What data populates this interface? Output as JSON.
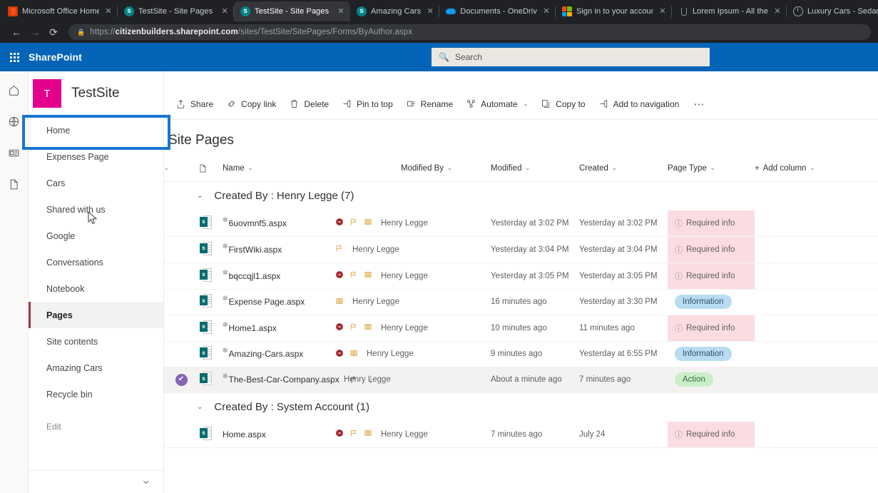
{
  "browser": {
    "tabs": [
      {
        "title": "Microsoft Office Home",
        "favicon": "office-icon",
        "active": false
      },
      {
        "title": "TestSite - Site Pages -",
        "favicon": "sharepoint-icon",
        "active": false
      },
      {
        "title": "TestSite - Site Pages -",
        "favicon": "sharepoint-icon",
        "active": true
      },
      {
        "title": "Amazing Cars",
        "favicon": "sharepoint-icon",
        "active": false
      },
      {
        "title": "Documents - OneDriv",
        "favicon": "onedrive-icon",
        "active": false
      },
      {
        "title": "Sign in to your accoun",
        "favicon": "microsoft-icon",
        "active": false
      },
      {
        "title": "Lorem Ipsum - All the",
        "favicon": "generic-icon",
        "active": false
      },
      {
        "title": "Luxury Cars - Sedans,",
        "favicon": "mercedes-icon",
        "active": false
      }
    ],
    "close_label": "✕",
    "back_icon": "←",
    "forward_icon": "→",
    "reload_icon": "⟳",
    "lock_icon": "🔒",
    "url_scheme": "https://",
    "url_domain": "citizenbuilders.sharepoint.com",
    "url_path": "/sites/TestSite/SitePages/Forms/ByAuthor.aspx"
  },
  "suite": {
    "waffle": "app-launcher-icon",
    "brand": "SharePoint",
    "search_icon": "search-icon",
    "search_placeholder": "Search"
  },
  "rail": {
    "items": [
      {
        "name": "home-icon"
      },
      {
        "name": "globe-icon"
      },
      {
        "name": "news-icon"
      },
      {
        "name": "document-icon"
      }
    ]
  },
  "site": {
    "logo_letter": "T",
    "logo_color": "#e3008c",
    "title": "TestSite",
    "nav": [
      {
        "label": "Home",
        "selected": false,
        "highlighted": true
      },
      {
        "label": "Expenses Page",
        "selected": false
      },
      {
        "label": "Cars",
        "selected": false
      },
      {
        "label": "Shared with us",
        "selected": false
      },
      {
        "label": "Google",
        "selected": false
      },
      {
        "label": "Conversations",
        "selected": false
      },
      {
        "label": "Notebook",
        "selected": false
      },
      {
        "label": "Pages",
        "selected": true
      },
      {
        "label": "Site contents",
        "selected": false
      },
      {
        "label": "Amazing Cars",
        "selected": false
      },
      {
        "label": "Recycle bin",
        "selected": false
      },
      {
        "label": "Edit",
        "selected": false,
        "muted": true
      }
    ],
    "collapse_icon": "chevron-down-icon"
  },
  "command_bar": [
    {
      "label": "Share",
      "icon": "share-icon",
      "chevron": false
    },
    {
      "label": "Copy link",
      "icon": "link-icon",
      "chevron": false
    },
    {
      "label": "Delete",
      "icon": "trash-icon",
      "chevron": false
    },
    {
      "label": "Pin to top",
      "icon": "pin-icon",
      "chevron": false
    },
    {
      "label": "Rename",
      "icon": "rename-icon",
      "chevron": false
    },
    {
      "label": "Automate",
      "icon": "automate-icon",
      "chevron": true
    },
    {
      "label": "Copy to",
      "icon": "copy-icon",
      "chevron": false
    },
    {
      "label": "Add to navigation",
      "icon": "add-nav-icon",
      "chevron": false
    }
  ],
  "command_more": "⋯",
  "list": {
    "title": "Site Pages",
    "columns": [
      {
        "key": "select",
        "label": "",
        "chevron": true
      },
      {
        "key": "icon",
        "label": "",
        "chevron": false
      },
      {
        "key": "name",
        "label": "Name",
        "chevron": true
      },
      {
        "key": "modified_by",
        "label": "Modified By",
        "chevron": true
      },
      {
        "key": "modified",
        "label": "Modified",
        "chevron": true
      },
      {
        "key": "created",
        "label": "Created",
        "chevron": true
      },
      {
        "key": "page_type",
        "label": "Page Type",
        "chevron": true
      }
    ],
    "add_column_label": "Add column",
    "groups": [
      {
        "title": "Created By : Henry Legge (7)",
        "rows": [
          {
            "name": "6uovmnf5.aspx",
            "new": true,
            "icons": [
              "error-icon",
              "flag-icon",
              "book-icon"
            ],
            "modified_by": "Henry Legge",
            "modified": "Yesterday at 3:02 PM",
            "created": "Yesterday at 3:02 PM",
            "page_type": "Required info",
            "page_type_style": "required",
            "selected": false
          },
          {
            "name": "FirstWiki.aspx",
            "new": true,
            "icons": [
              "flag-icon"
            ],
            "modified_by": "Henry Legge",
            "modified": "Yesterday at 3:04 PM",
            "created": "Yesterday at 3:04 PM",
            "page_type": "Required info",
            "page_type_style": "required",
            "selected": false
          },
          {
            "name": "bqccqjl1.aspx",
            "new": true,
            "icons": [
              "error-icon",
              "flag-icon",
              "book-icon"
            ],
            "modified_by": "Henry Legge",
            "modified": "Yesterday at 3:05 PM",
            "created": "Yesterday at 3:05 PM",
            "page_type": "Required info",
            "page_type_style": "required",
            "selected": false
          },
          {
            "name": "Expense Page.aspx",
            "new": true,
            "icons": [
              "book-icon"
            ],
            "modified_by": "Henry Legge",
            "modified": "16 minutes ago",
            "created": "Yesterday at 3:30 PM",
            "page_type": "Information",
            "page_type_style": "info",
            "selected": false
          },
          {
            "name": "Home1.aspx",
            "new": true,
            "icons": [
              "error-icon",
              "flag-icon",
              "book-icon"
            ],
            "modified_by": "Henry Legge",
            "modified": "10 minutes ago",
            "created": "11 minutes ago",
            "page_type": "Required info",
            "page_type_style": "required",
            "selected": false
          },
          {
            "name": "Amazing-Cars.aspx",
            "new": true,
            "icons": [
              "error-icon",
              "book-icon"
            ],
            "modified_by": "Henry Legge",
            "modified": "9 minutes ago",
            "created": "Yesterday at 6:55 PM",
            "page_type": "Information",
            "page_type_style": "info",
            "selected": false
          },
          {
            "name": "The-Best-Car-Company.aspx",
            "new": true,
            "icons": [],
            "row_actions": [
              "share-icon",
              "more-vertical-icon"
            ],
            "modified_by": "Henry Legge",
            "modified": "About a minute ago",
            "created": "7 minutes ago",
            "page_type": "Action",
            "page_type_style": "action",
            "selected": true
          }
        ]
      },
      {
        "title": "Created By : System Account (1)",
        "rows": [
          {
            "name": "Home.aspx",
            "new": false,
            "icons": [
              "error-icon",
              "flag-icon",
              "book-icon"
            ],
            "modified_by": "Henry Legge",
            "modified": "7 minutes ago",
            "created": "July 24",
            "page_type": "Required info",
            "page_type_style": "required",
            "selected": false
          }
        ]
      }
    ]
  },
  "glyphs": {
    "chevron_down": "⌄",
    "warn": "ⓘ",
    "check": "✔",
    "sparkle": "❇",
    "plus": "+",
    "error_dot": "⛔",
    "flag": "⚐",
    "book": "☐",
    "share": "↱",
    "more_vertical": "⋮"
  },
  "colors": {
    "suite_bar": "#0364b8",
    "accent_site": "#e3008c",
    "highlight_box": "#1576d2",
    "selected_check": "#8764b8",
    "required_bg": "#fbdde1",
    "info_bg": "#b8dcf2",
    "action_bg": "#c9efc9"
  }
}
